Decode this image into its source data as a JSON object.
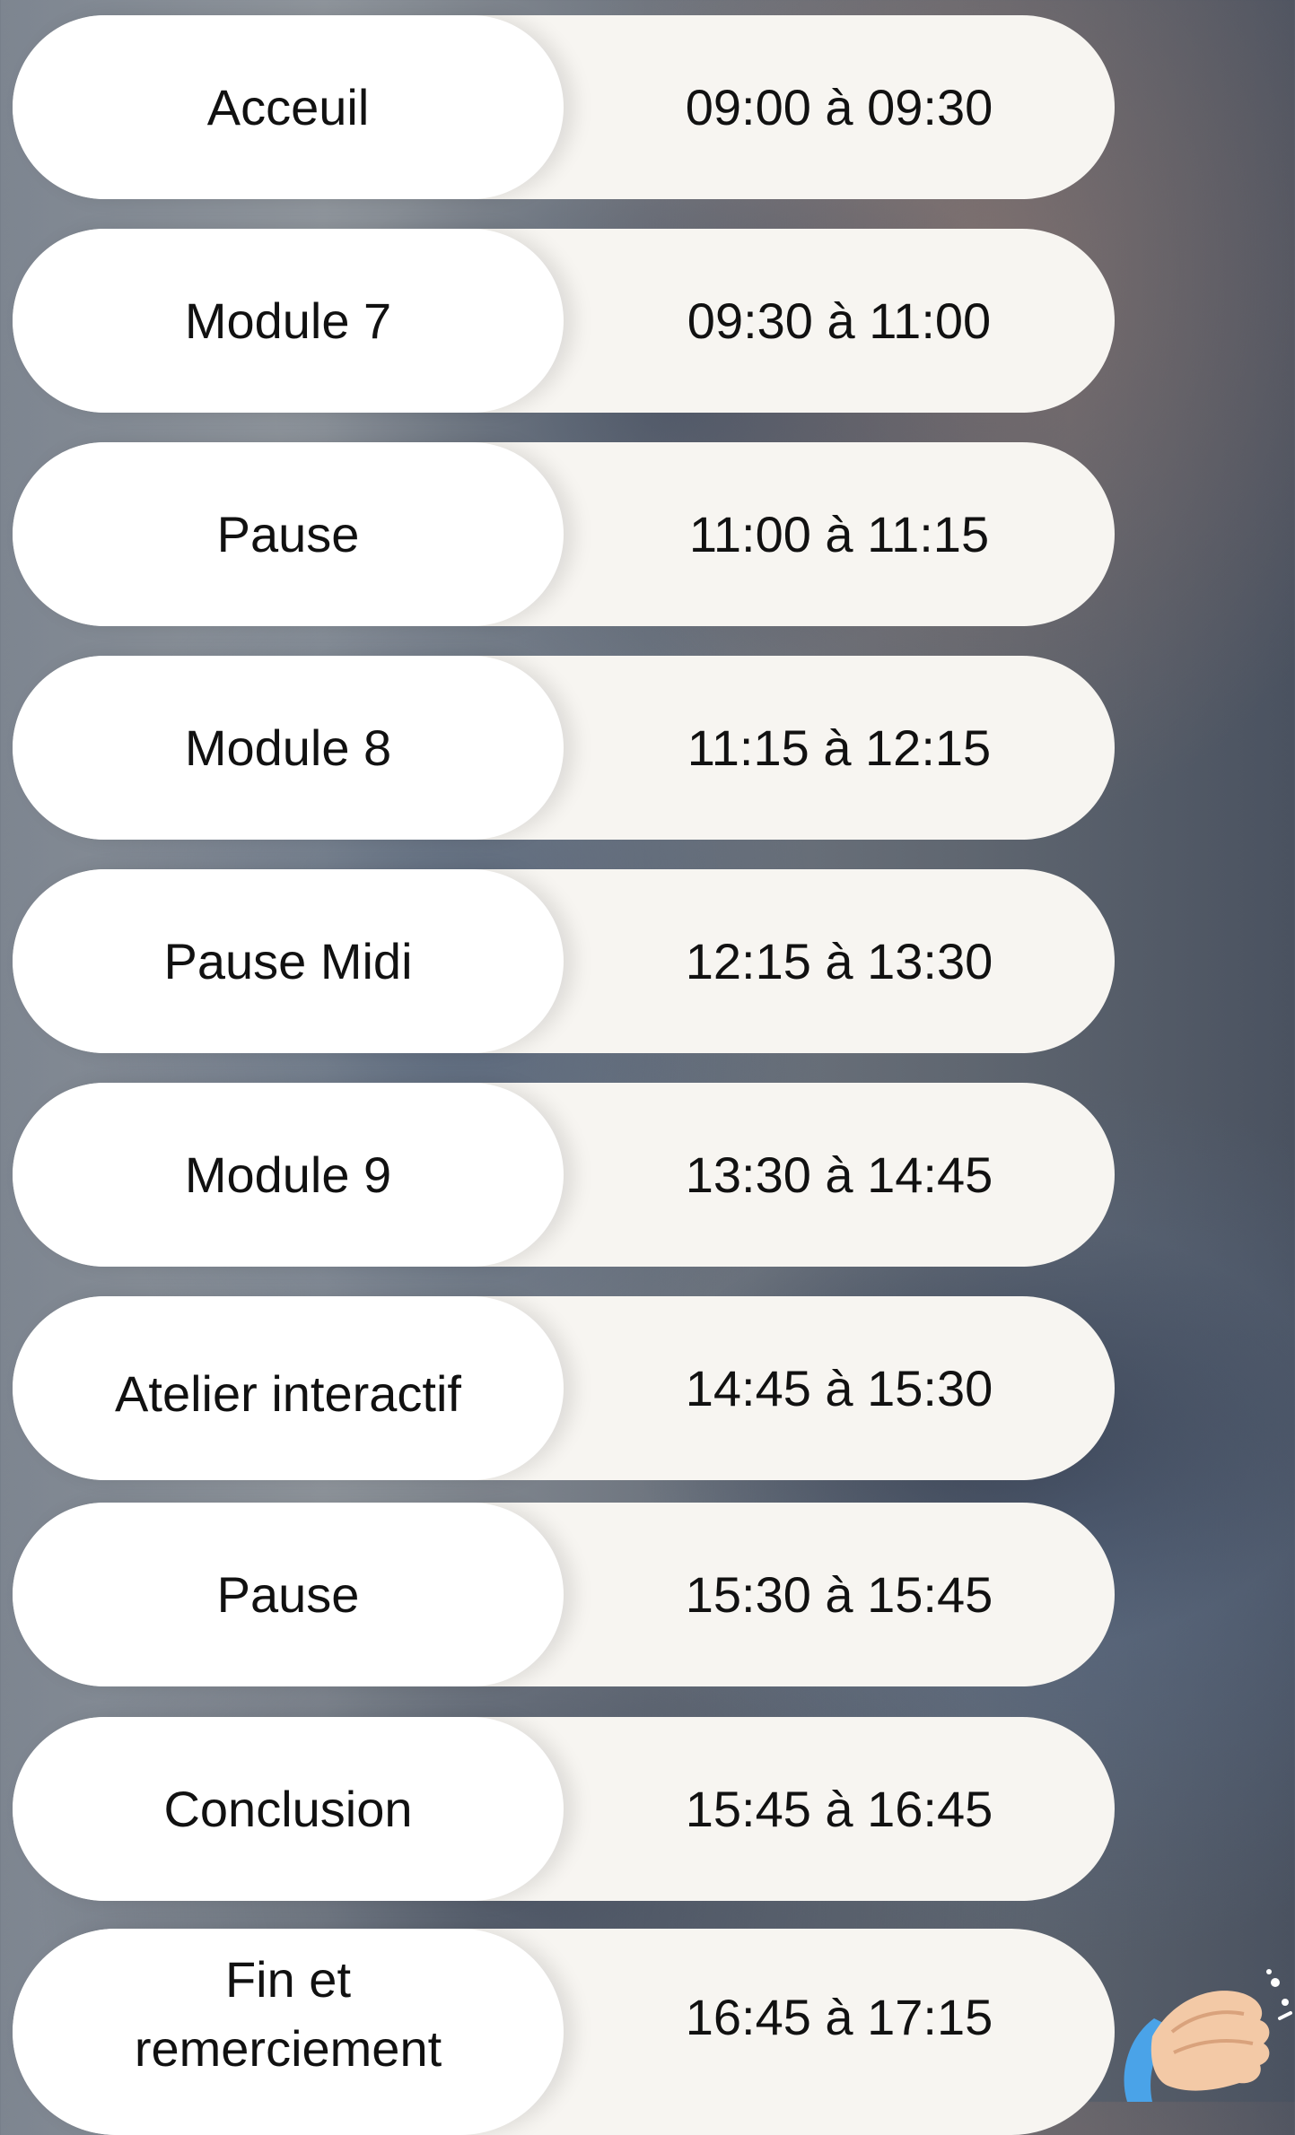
{
  "schedule": {
    "items": [
      {
        "label": "Acceuil",
        "time": "09:00 à 09:30"
      },
      {
        "label": "Module 7",
        "time": "09:30 à 11:00"
      },
      {
        "label": "Pause",
        "time": "11:00 à 11:15"
      },
      {
        "label": "Module 8",
        "time": "11:15 à 12:15"
      },
      {
        "label": "Pause Midi",
        "time": "12:15 à 13:30"
      },
      {
        "label": "Module 9",
        "time": "13:30 à 14:45"
      },
      {
        "label": "Atelier interactif",
        "time": "14:45 à 15:30"
      },
      {
        "label": "Pause",
        "time": "15:30 à 15:45"
      },
      {
        "label": "Conclusion",
        "time": "15:45 à 16:45"
      },
      {
        "label": "Fin et\nremerciement",
        "time": "16:45 à 17:15"
      }
    ]
  },
  "decoration": {
    "icon": "clapping-hands-icon"
  }
}
